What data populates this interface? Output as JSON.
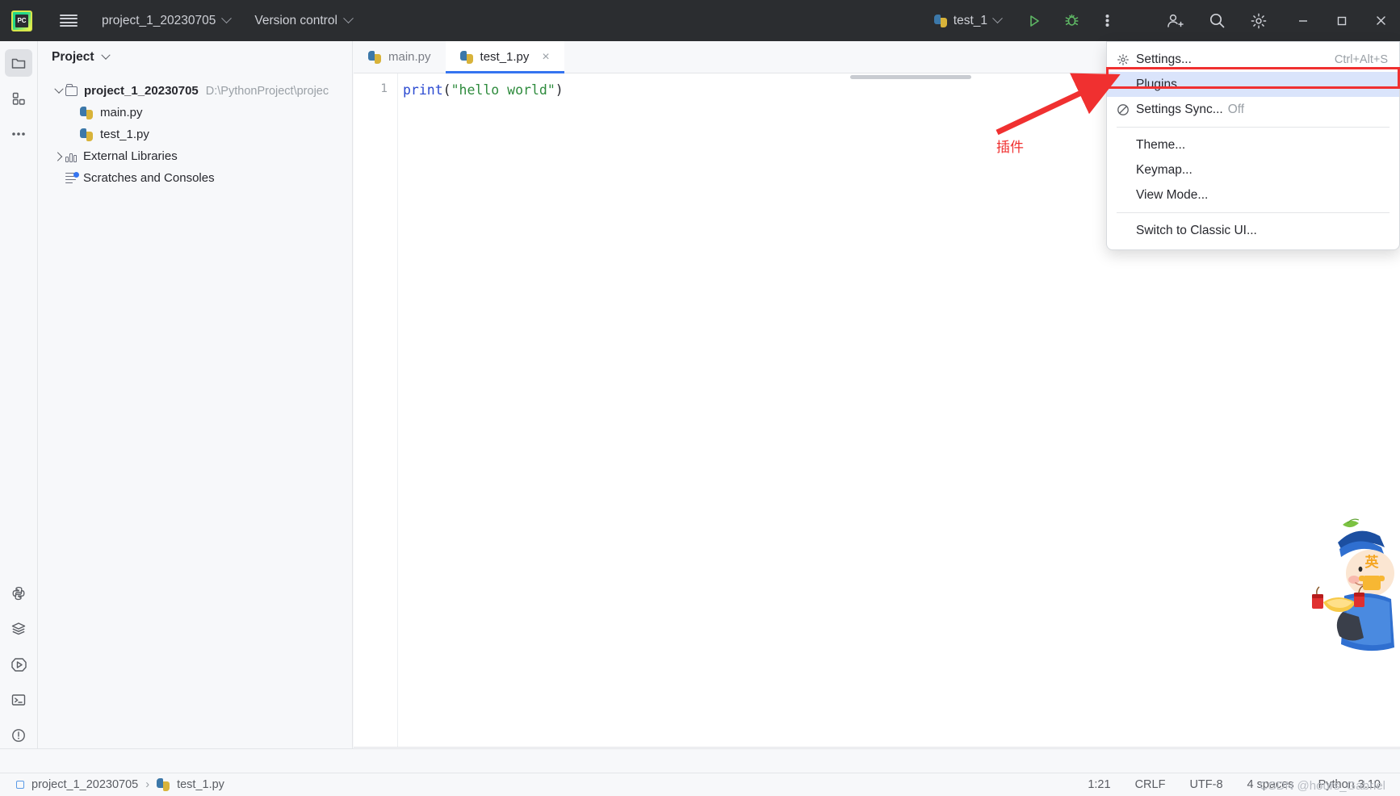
{
  "titlebar": {
    "logo_alt": "pycharm-logo",
    "project_name": "project_1_20230705",
    "vcs_label": "Version control",
    "run_config": "test_1",
    "icons": [
      "hamburger-icon",
      "run-icon",
      "debug-icon",
      "more-vertical-icon",
      "add-user-icon",
      "search-icon",
      "gear-icon"
    ],
    "window_controls": [
      "minimize",
      "maximize",
      "close"
    ]
  },
  "left_toolstrip": {
    "items": [
      {
        "name": "project-tool-icon",
        "active": true
      },
      {
        "name": "commit-tool-icon",
        "active": false
      },
      {
        "name": "more-tools-icon",
        "active": false
      },
      {
        "name": "python-packages-icon",
        "active": false
      },
      {
        "name": "database-icon",
        "active": false
      },
      {
        "name": "run-tool-icon",
        "active": false
      },
      {
        "name": "terminal-icon",
        "active": false
      },
      {
        "name": "problems-icon",
        "active": false
      },
      {
        "name": "version-control-icon",
        "active": false
      }
    ]
  },
  "project_panel": {
    "title": "Project",
    "tree": [
      {
        "label": "project_1_20230705",
        "path": "D:\\PythonProject\\projec",
        "type": "folder",
        "expanded": true,
        "depth": 0
      },
      {
        "label": "main.py",
        "path": "",
        "type": "python",
        "expanded": null,
        "depth": 1
      },
      {
        "label": "test_1.py",
        "path": "",
        "type": "python",
        "expanded": null,
        "depth": 1
      },
      {
        "label": "External Libraries",
        "path": "",
        "type": "library",
        "expanded": false,
        "depth": 0
      },
      {
        "label": "Scratches and Consoles",
        "path": "",
        "type": "scratch",
        "expanded": null,
        "depth": 0
      }
    ]
  },
  "editor": {
    "tabs": [
      {
        "label": "main.py",
        "active": false,
        "closable": false
      },
      {
        "label": "test_1.py",
        "active": true,
        "closable": true
      }
    ],
    "close_glyph": "×",
    "line_numbers": [
      "1"
    ],
    "code": {
      "fn": "print",
      "open_paren": "(",
      "string": "\"hello world\"",
      "close_paren": ")"
    }
  },
  "menu": {
    "items": [
      {
        "label": "Settings...",
        "shortcut": "Ctrl+Alt+S",
        "icon": "gear-icon",
        "selected": false,
        "sub": "",
        "separator_after": false
      },
      {
        "label": "Plugins...",
        "shortcut": "",
        "icon": "",
        "selected": true,
        "sub": "",
        "separator_after": false
      },
      {
        "label": "Settings Sync...",
        "shortcut": "",
        "icon": "no-sync-icon",
        "selected": false,
        "sub": "Off",
        "separator_after": true
      },
      {
        "label": "Theme...",
        "shortcut": "",
        "icon": "",
        "selected": false,
        "sub": "",
        "separator_after": false
      },
      {
        "label": "Keymap...",
        "shortcut": "",
        "icon": "",
        "selected": false,
        "sub": "",
        "separator_after": false
      },
      {
        "label": "View Mode...",
        "shortcut": "",
        "icon": "",
        "selected": false,
        "sub": "",
        "separator_after": true
      },
      {
        "label": "Switch to Classic UI...",
        "shortcut": "",
        "icon": "",
        "selected": false,
        "sub": "",
        "separator_after": false
      }
    ]
  },
  "annotation": {
    "text": "插件",
    "highlight_color": "#f03030"
  },
  "statusbar": {
    "breadcrumb_project": "project_1_20230705",
    "breadcrumb_separator": "›",
    "breadcrumb_file": "test_1.py",
    "caret": "1:21",
    "line_sep": "CRLF",
    "encoding": "UTF-8",
    "indent": "4 spaces",
    "interpreter": "Python 3.10"
  },
  "watermark": {
    "text": "CSDN @hours_Gabriel"
  },
  "ime": {
    "badge": "英"
  },
  "colors": {
    "titlebar_bg": "#2b2d30",
    "panel_bg": "#f7f8fa",
    "editor_bg": "#ffffff",
    "accent_blue": "#3574f0",
    "selection_blue": "#dae4fb",
    "string_green": "#2e8b3d",
    "keyword_blue": "#2b4ad1",
    "run_green": "#5fb865"
  }
}
